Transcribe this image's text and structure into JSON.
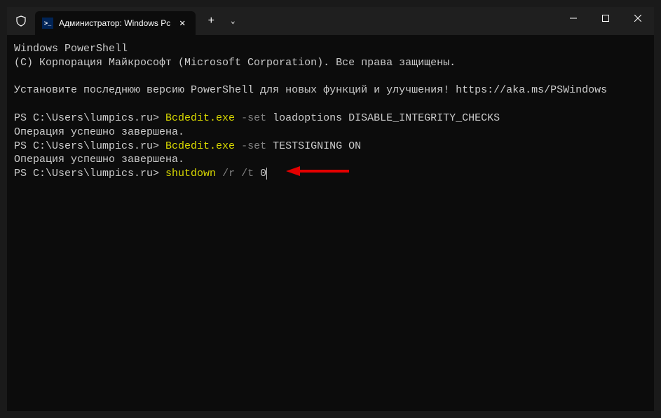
{
  "tab": {
    "title": "Администратор: Windows Pc"
  },
  "term": {
    "l1": "Windows PowerShell",
    "l2": "(C) Корпорация Майкрософт (Microsoft Corporation). Все права защищены.",
    "l3": "Установите последнюю версию PowerShell для новых функций и улучшения! https://aka.ms/PSWindows",
    "ps": "PS C:\\Users\\lumpics.ru> ",
    "cmd1a": "Bcdedit.exe ",
    "cmd1b": "-set ",
    "cmd1c": "loadoptions DISABLE_INTEGRITY_CHECKS",
    "ok": "Операция успешно завершена.",
    "cmd2a": "Bcdedit.exe ",
    "cmd2b": "-set ",
    "cmd2c": "TESTSIGNING ON",
    "cmd3a": "shutdown ",
    "cmd3b": "/r /t ",
    "cmd3c": "0"
  }
}
